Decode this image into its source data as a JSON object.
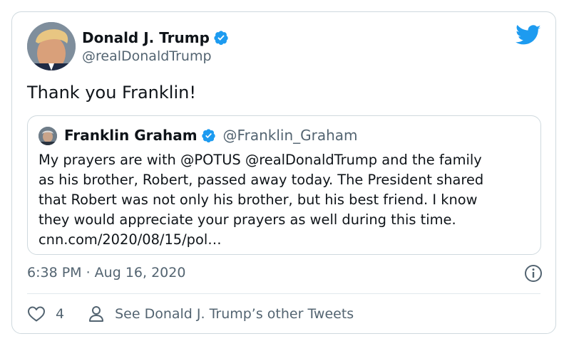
{
  "author": {
    "name": "Donald J. Trump",
    "handle": "@realDonaldTrump"
  },
  "tweet": {
    "text": "Thank you Franklin!",
    "timestamp": "6:38 PM · Aug 16, 2020"
  },
  "quoted_tweet": {
    "name": "Franklin Graham",
    "handle": "@Franklin_Graham",
    "lines": [
      "My prayers are with @POTUS @realDonaldTrump and the family",
      "as his brother, Robert, passed away today. The President shared",
      "that Robert was not only his brother, but his best friend. I know",
      "they would appreciate your prayers as well during this time.",
      "cnn.com/2020/08/15/pol…"
    ]
  },
  "actions": {
    "like_count": "4",
    "other_tweets_label": "See Donald J. Trump’s other Tweets"
  },
  "colors": {
    "twitter_blue": "#1d9bf0",
    "text_primary": "#0f1419",
    "text_secondary": "#536471",
    "border": "#cfd9de"
  },
  "icons": [
    "twitter-bird-icon",
    "verified-badge-icon",
    "info-icon",
    "heart-icon",
    "person-icon"
  ]
}
